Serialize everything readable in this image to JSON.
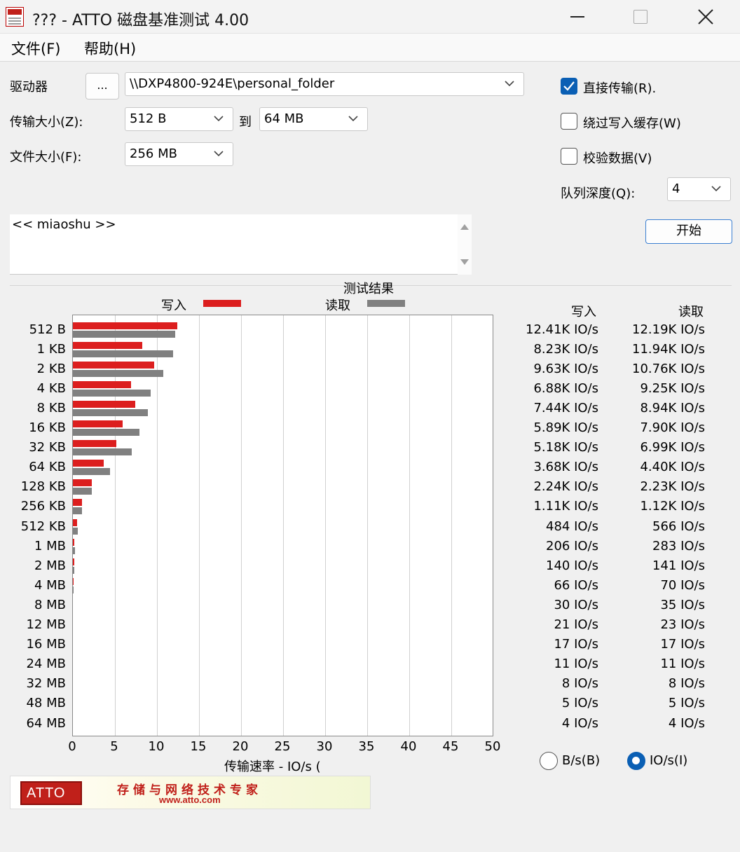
{
  "window": {
    "title": "??? - ATTO 磁盘基准测试 4.00"
  },
  "menu": [
    {
      "label": "文件(F)"
    },
    {
      "label": "帮助(H)"
    }
  ],
  "settings": {
    "drive_label": "驱动器",
    "browse_label": "...",
    "drive_value": "\\\\DXP4800-924E\\personal_folder",
    "transfer_label": "传输大小(Z):",
    "transfer_from": "512 B",
    "to_label": "到",
    "transfer_to": "64 MB",
    "file_size_label": "文件大小(F):",
    "file_size": "256 MB",
    "direct_io_label": "直接传输(R).",
    "direct_io_checked": true,
    "bypass_cache_label": "绕过写入缓存(W)",
    "bypass_cache_checked": false,
    "verify_label": "校验数据(V)",
    "verify_checked": false,
    "queue_label": "队列深度(Q):",
    "queue_depth": "4",
    "start_label": "开始",
    "description": "<< miaoshu >>"
  },
  "results": {
    "title": "测试结果",
    "legend": {
      "write_label": "写入",
      "read_label": "读取",
      "write_color": "#dc1e1e",
      "read_color": "#808080"
    },
    "write_header": "写入",
    "read_header": "读取",
    "rows": [
      {
        "size": "512 B",
        "write": "12.41K IO/s",
        "read": "12.19K IO/s"
      },
      {
        "size": "1 KB",
        "write": "8.23K IO/s",
        "read": "11.94K IO/s"
      },
      {
        "size": "2 KB",
        "write": "9.63K IO/s",
        "read": "10.76K IO/s"
      },
      {
        "size": "4 KB",
        "write": "6.88K IO/s",
        "read": "9.25K IO/s"
      },
      {
        "size": "8 KB",
        "write": "7.44K IO/s",
        "read": "8.94K IO/s"
      },
      {
        "size": "16 KB",
        "write": "5.89K IO/s",
        "read": "7.90K IO/s"
      },
      {
        "size": "32 KB",
        "write": "5.18K IO/s",
        "read": "6.99K IO/s"
      },
      {
        "size": "64 KB",
        "write": "3.68K IO/s",
        "read": "4.40K IO/s"
      },
      {
        "size": "128 KB",
        "write": "2.24K IO/s",
        "read": "2.23K IO/s"
      },
      {
        "size": "256 KB",
        "write": "1.11K IO/s",
        "read": "1.12K IO/s"
      },
      {
        "size": "512 KB",
        "write": "484 IO/s",
        "read": "566 IO/s"
      },
      {
        "size": "1 MB",
        "write": "206 IO/s",
        "read": "283 IO/s"
      },
      {
        "size": "2 MB",
        "write": "140 IO/s",
        "read": "141 IO/s"
      },
      {
        "size": "4 MB",
        "write": "66 IO/s",
        "read": "70 IO/s"
      },
      {
        "size": "8 MB",
        "write": "30 IO/s",
        "read": "35 IO/s"
      },
      {
        "size": "12 MB",
        "write": "21 IO/s",
        "read": "23 IO/s"
      },
      {
        "size": "16 MB",
        "write": "17 IO/s",
        "read": "17 IO/s"
      },
      {
        "size": "24 MB",
        "write": "11 IO/s",
        "read": "11 IO/s"
      },
      {
        "size": "32 MB",
        "write": "8 IO/s",
        "read": "8 IO/s"
      },
      {
        "size": "48 MB",
        "write": "5 IO/s",
        "read": "5 IO/s"
      },
      {
        "size": "64 MB",
        "write": "4 IO/s",
        "read": "4 IO/s"
      }
    ],
    "unit_bytes_label": "B/s(B)",
    "unit_io_label": "IO/s(I)",
    "unit_selected": "io"
  },
  "chart_data": {
    "type": "bar",
    "orientation": "horizontal",
    "xlabel": "传输速率 - IO/s (",
    "xlim": [
      0,
      50
    ],
    "xticks": [
      "0",
      "5",
      "10",
      "15",
      "20",
      "25",
      "30",
      "35",
      "40",
      "45",
      "50"
    ],
    "categories": [
      "512 B",
      "1 KB",
      "2 KB",
      "4 KB",
      "8 KB",
      "16 KB",
      "32 KB",
      "64 KB",
      "128 KB",
      "256 KB",
      "512 KB",
      "1 MB",
      "2 MB",
      "4 MB",
      "8 MB",
      "12 MB",
      "16 MB",
      "24 MB",
      "32 MB",
      "48 MB",
      "64 MB"
    ],
    "series": [
      {
        "name": "写入",
        "color": "#dc1e1e",
        "values": [
          12.41,
          8.23,
          9.63,
          6.88,
          7.44,
          5.89,
          5.18,
          3.68,
          2.24,
          1.11,
          0.484,
          0.206,
          0.14,
          0.066,
          0.03,
          0.021,
          0.017,
          0.011,
          0.008,
          0.005,
          0.004
        ]
      },
      {
        "name": "读取",
        "color": "#808080",
        "values": [
          12.19,
          11.94,
          10.76,
          9.25,
          8.94,
          7.9,
          6.99,
          4.4,
          2.23,
          1.12,
          0.566,
          0.283,
          0.141,
          0.07,
          0.035,
          0.023,
          0.017,
          0.011,
          0.008,
          0.005,
          0.004
        ]
      }
    ],
    "grid": true,
    "legend": "top"
  },
  "banner": {
    "logo_text": "ATTO",
    "slogan": "存储与网络技术专家",
    "url": "www.atto.com",
    "brand_color": "#c0201a"
  }
}
